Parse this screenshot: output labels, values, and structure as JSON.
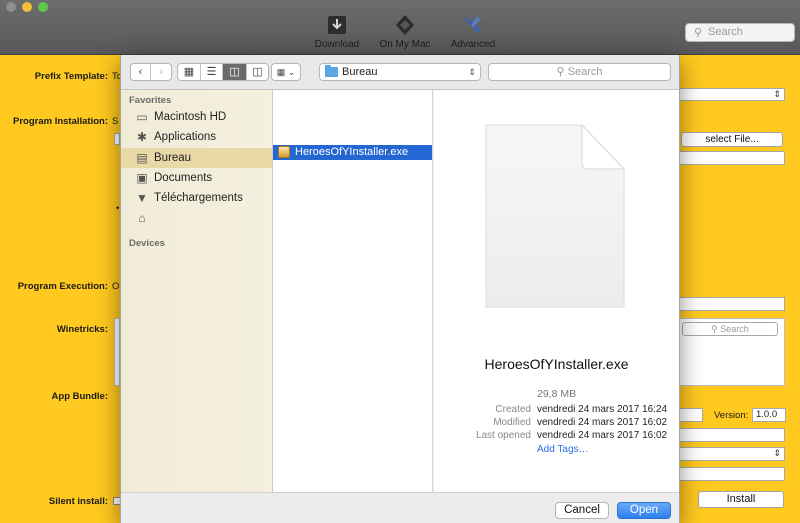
{
  "toolbar": {
    "buttons": [
      {
        "label": "Download",
        "icon": "download-icon"
      },
      {
        "label": "On My Mac",
        "icon": "cube-icon"
      },
      {
        "label": "Advanced",
        "icon": "wrench-icon"
      }
    ],
    "search_placeholder": "Search"
  },
  "form": {
    "prefix_template_label": "Prefix Template:",
    "prefix_template_value": "To",
    "program_installation_label": "Program Installation:",
    "program_installation_value": "S",
    "select_file_button": "select File...",
    "program_execution_label": "Program Execution:",
    "program_execution_value": "O",
    "winetricks_label": "Winetricks:",
    "winetricks_search_placeholder": "Search",
    "app_bundle_label": "App Bundle:",
    "version_label": "Version:",
    "version_value": "1.0.0",
    "silent_install_label": "Silent install:",
    "install_button": "Install"
  },
  "dialog": {
    "location": "Bureau",
    "search_placeholder": "Search",
    "sidebar": {
      "favorites_header": "Favorites",
      "devices_header": "Devices",
      "items": [
        {
          "label": "Macintosh HD",
          "icon": "harddrive-icon"
        },
        {
          "label": "Applications",
          "icon": "applications-icon"
        },
        {
          "label": "Bureau",
          "icon": "desktop-icon"
        },
        {
          "label": "Documents",
          "icon": "documents-icon"
        },
        {
          "label": "Téléchargements",
          "icon": "downloads-icon"
        },
        {
          "label": "",
          "icon": "home-icon"
        }
      ],
      "selected": "Bureau"
    },
    "files": [
      "HeroesOfYInstaller.exe"
    ],
    "preview": {
      "name": "HeroesOfYInstaller.exe",
      "size": "29,8 MB",
      "created_label": "Created",
      "created": "vendredi 24 mars 2017 16:24",
      "modified_label": "Modified",
      "modified": "vendredi 24 mars 2017 16:02",
      "last_opened_label": "Last opened",
      "last_opened": "vendredi 24 mars 2017 16:02",
      "add_tags": "Add Tags…"
    },
    "cancel_button": "Cancel",
    "open_button": "Open"
  },
  "colors": {
    "background": "#FFC91F",
    "selection": "#2467D2",
    "open_button": "#2D7FF0"
  }
}
